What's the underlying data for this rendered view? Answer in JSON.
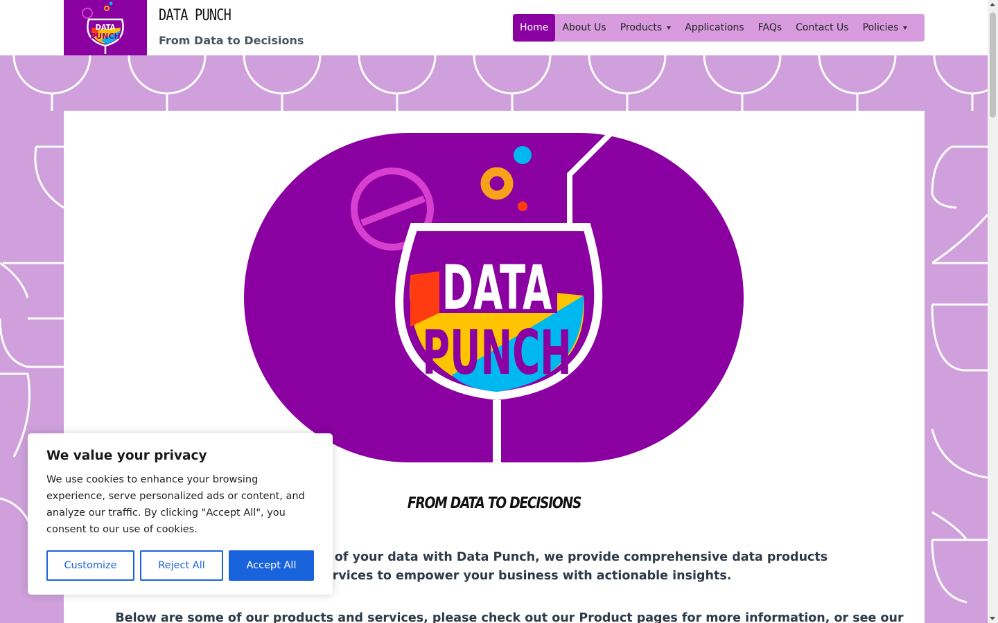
{
  "header": {
    "brand_title": "DATA PUNCH",
    "brand_tagline": "From Data to Decisions",
    "logo_text_top": "DATA",
    "logo_text_bottom": "PUNCH"
  },
  "nav": {
    "items": [
      {
        "label": "Home",
        "active": true,
        "has_dropdown": false
      },
      {
        "label": "About Us",
        "active": false,
        "has_dropdown": false
      },
      {
        "label": "Products",
        "active": false,
        "has_dropdown": true
      },
      {
        "label": "Applications",
        "active": false,
        "has_dropdown": false
      },
      {
        "label": "FAQs",
        "active": false,
        "has_dropdown": false
      },
      {
        "label": "Contact Us",
        "active": false,
        "has_dropdown": false
      },
      {
        "label": "Policies",
        "active": false,
        "has_dropdown": true
      }
    ]
  },
  "hero": {
    "logo_text_top": "DATA",
    "logo_text_bottom": "PUNCH",
    "tagline": "FROM DATA TO DECISIONS"
  },
  "content": {
    "para1_line1": "Unlock the potential of your data with Data Punch, we provide comprehensive data products",
    "para1_line2": "and services to empower your business with actionable insights.",
    "para2": "Below are some of our products and services, please check out our Product pages for more information, or see our"
  },
  "cookie": {
    "title": "We value your privacy",
    "text": "We use cookies to enhance your browsing experience, serve personalized ads or content, and analyze our traffic. By clicking \"Accept All\", you consent to our use of cookies.",
    "customize_label": "Customize",
    "reject_label": "Reject All",
    "accept_label": "Accept All"
  },
  "colors": {
    "brand_purple": "#8a00a0",
    "nav_bg": "#d79bde",
    "pattern_bg": "#cfa0db",
    "cookie_blue": "#1863dc",
    "logo_red": "#ff3b12",
    "logo_yellow": "#ffc400",
    "logo_cyan": "#00b8f0",
    "logo_orange": "#f7a21b",
    "logo_magenta": "#d63fcf"
  }
}
